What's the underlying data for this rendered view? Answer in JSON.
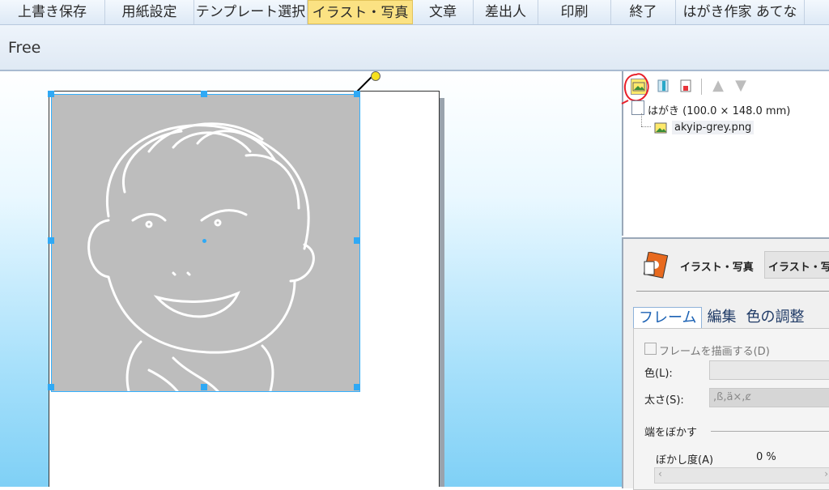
{
  "menubar": {
    "items": [
      {
        "label": "上書き保存",
        "active": false
      },
      {
        "label": "用紙設定",
        "active": false
      },
      {
        "label": "テンプレート選択",
        "active": false
      },
      {
        "label": "イラスト・写真",
        "active": true
      },
      {
        "label": "文章",
        "active": false
      },
      {
        "label": "差出人",
        "active": false
      },
      {
        "label": "印刷",
        "active": false
      },
      {
        "label": "終了",
        "active": false
      },
      {
        "label": "はがき作家 あてな",
        "active": false
      }
    ]
  },
  "toolbar": {
    "label": "Free"
  },
  "layer_panel": {
    "buttons": [
      "image-icon",
      "text-frame-icon",
      "shape-icon",
      "up-arrow-icon",
      "down-arrow-icon"
    ],
    "tree_root": "はがき (100.0 × 148.0 mm)",
    "tree_child": "akyip-grey.png"
  },
  "properties": {
    "title": "イラスト・写真",
    "dropdown_value": "イラスト・写真",
    "tabs": [
      "フレーム",
      "編集",
      "色の調整"
    ],
    "draw_frame_label": "フレームを描画する(D)",
    "color_label": "色(L):",
    "thickness_label": "太さ(S):",
    "thickness_value": ",ß,ä×,ȼ",
    "blur_section": "端をぼかす",
    "blur_label": "ぼかし度(A)",
    "blur_value": "0 %"
  },
  "colors": {
    "accent": "#2fa9f5",
    "annotation": "#e8202a",
    "active_menu": "#fbe283"
  }
}
